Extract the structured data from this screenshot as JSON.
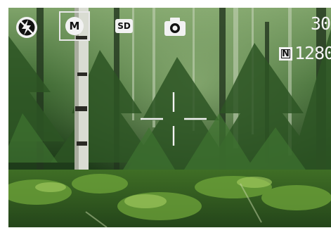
{
  "screen": {
    "type": "camera-viewfinder",
    "scene": "forest"
  },
  "osd": {
    "flash_icon": "flash-off-icon",
    "mode_icon": "manual-mode-icon",
    "mode_letter": "M",
    "mode_selected": true,
    "storage_label": "SD",
    "capture_icon": "camera-icon",
    "shots_remaining": "30",
    "quality_label": "N",
    "resolution": "1280"
  },
  "colors": {
    "osd_text": "#f4f4f4",
    "badge_bg": "#f2f2f2",
    "badge_text": "#111111"
  }
}
